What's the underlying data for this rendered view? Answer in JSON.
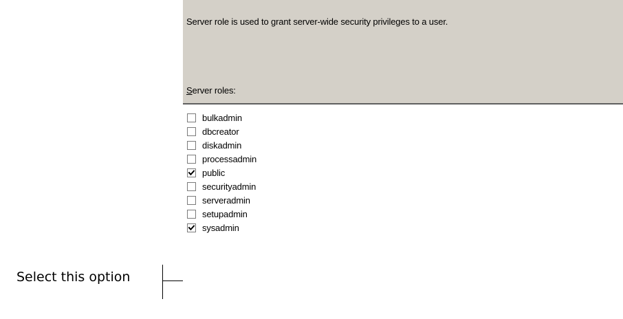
{
  "dialog": {
    "description": "Server role is used to grant server-wide security privileges to a user.",
    "roles_label_mnemonic": "S",
    "roles_label_rest": "erver roles:"
  },
  "roles": [
    {
      "name": "bulkadmin",
      "checked": false
    },
    {
      "name": "dbcreator",
      "checked": false
    },
    {
      "name": "diskadmin",
      "checked": false
    },
    {
      "name": "processadmin",
      "checked": false
    },
    {
      "name": "public",
      "checked": true
    },
    {
      "name": "securityadmin",
      "checked": false
    },
    {
      "name": "serveradmin",
      "checked": false
    },
    {
      "name": "setupadmin",
      "checked": false
    },
    {
      "name": "sysadmin",
      "checked": true
    }
  ],
  "annotation": {
    "text": "Select this option"
  },
  "colors": {
    "dialog_background": "#d4d0c8",
    "list_background": "#ffffff",
    "checkbox_border": "#7a7a7a"
  }
}
